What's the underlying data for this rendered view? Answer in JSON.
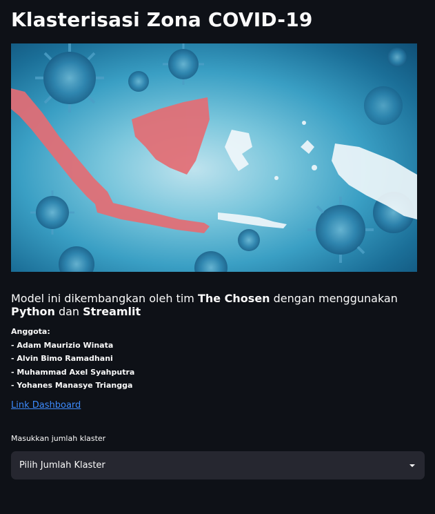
{
  "page": {
    "title": "Klasterisasi Zona COVID-19"
  },
  "banner": {
    "image_name": "indonesia-map-covid-virus-banner",
    "colors": {
      "highlight_region": "#e46d74",
      "background": "#3a9fc4"
    }
  },
  "intro": {
    "part1": "Model ini dikembangkan oleh tim ",
    "team": "The Chosen",
    "part2": " dengan menggunakan ",
    "tool1": "Python",
    "part3": " dan ",
    "tool2": "Streamlit"
  },
  "members": {
    "heading": "Anggota:",
    "list": [
      "- Adam Maurizio Winata",
      "- Alvin Bimo Ramadhani",
      "- Muhammad Axel Syahputra",
      "- Yohanes Manasye Triangga"
    ]
  },
  "link": {
    "label": "Link Dashboard"
  },
  "select": {
    "label": "Masukkan jumlah klaster",
    "value": "Pilih Jumlah Klaster",
    "icon": "chevron-down-icon"
  },
  "colors": {
    "background": "#0e1117",
    "text": "#fafafa",
    "link": "#3d8bfd",
    "select_bg": "#262730"
  }
}
